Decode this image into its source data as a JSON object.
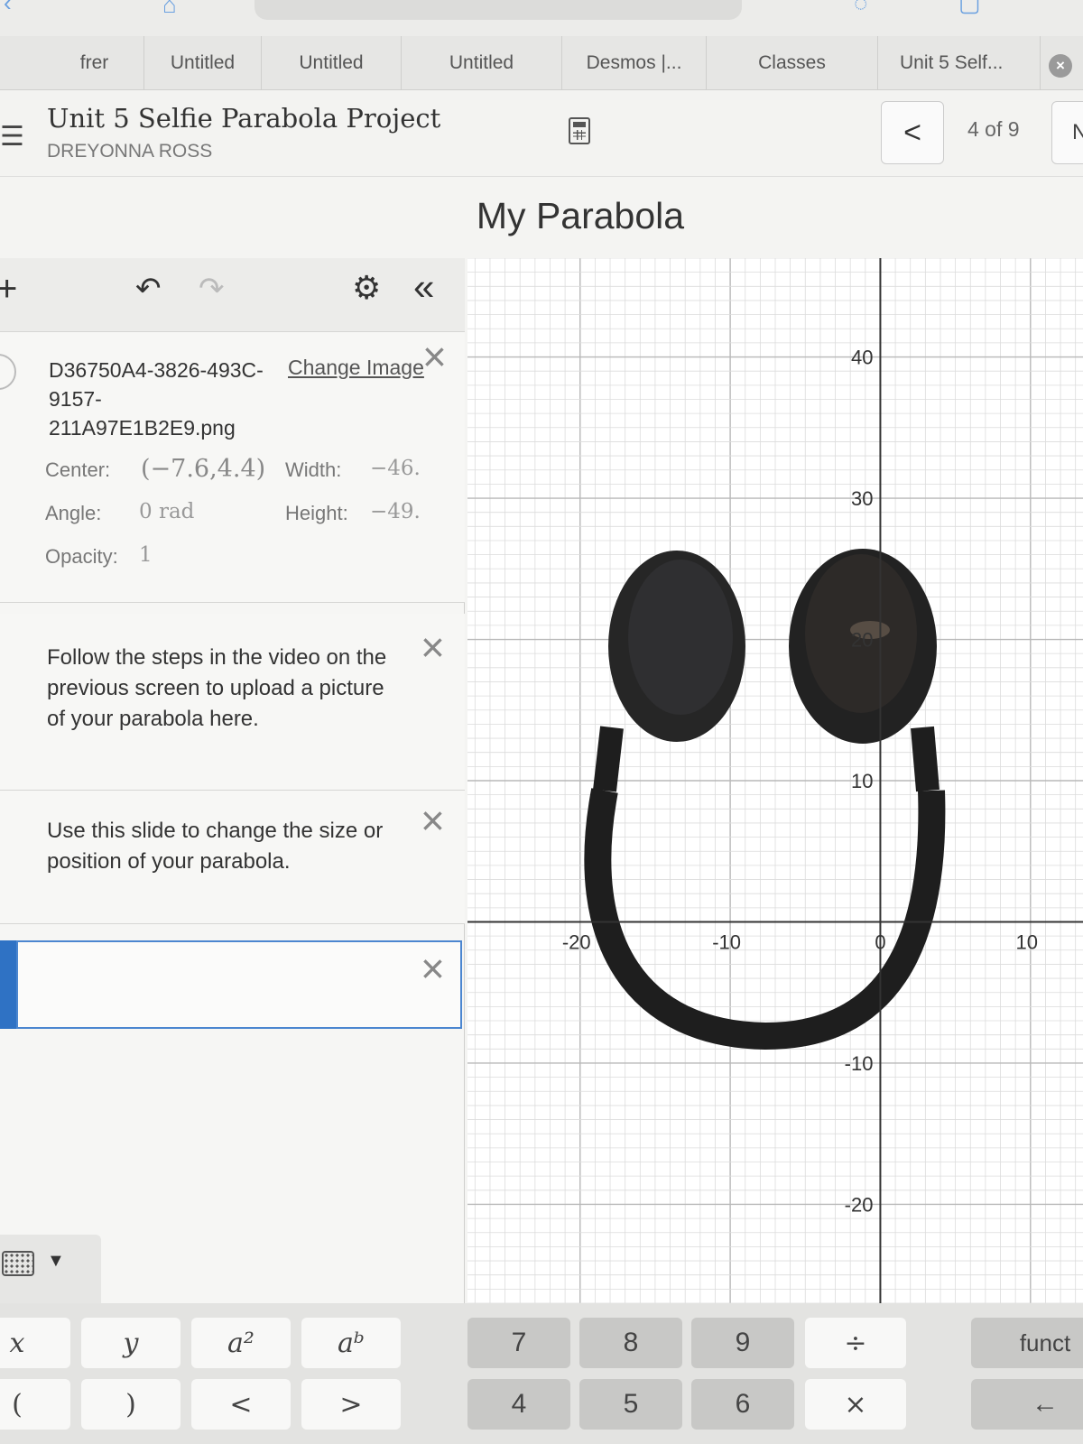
{
  "tabs": [
    {
      "label": "frer"
    },
    {
      "label": "Untitled"
    },
    {
      "label": "Untitled"
    },
    {
      "label": "Untitled"
    },
    {
      "label": "Desmos |..."
    },
    {
      "label": "Classes"
    },
    {
      "label": "Unit 5 Self..."
    }
  ],
  "header": {
    "title": "Unit 5 Selfie Parabola Project",
    "student": "DREYONNA ROSS",
    "page_indicator": "4 of 9",
    "prev_label": "<",
    "next_label": "N"
  },
  "screen_title": "My Parabola",
  "expression_panel": {
    "image_item": {
      "filename": "D36750A4-3826-493C-9157-211A97E1B2E9.png",
      "change_link": "Change Image",
      "center_label": "Center:",
      "center_value": "(−7.6,4.4)",
      "width_label": "Width:",
      "width_value": "−46.",
      "angle_label": "Angle:",
      "angle_value": "0 rad",
      "height_label": "Height:",
      "height_value": "−49.",
      "opacity_label": "Opacity:",
      "opacity_value": "1"
    },
    "notes": [
      "Follow the steps in the video on the previous screen to upload a picture of your parabola here.",
      "Use this slide to change the size or position of your parabola."
    ]
  },
  "keypad": {
    "row1": [
      "x",
      "y",
      "a²",
      "aᵇ",
      "7",
      "8",
      "9",
      "÷",
      "funct"
    ],
    "row2": [
      "(",
      ")",
      "<",
      ">",
      "4",
      "5",
      "6",
      "×",
      "←"
    ]
  },
  "colors": {
    "accent": "#2f72c4",
    "panel_bg": "#f6f6f4",
    "grid_minor": "#dcdcdc",
    "grid_major": "#b8b8b8"
  },
  "chart_data": {
    "type": "scatter",
    "x_ticks": [
      "-20",
      "-10",
      "0",
      "10"
    ],
    "y_ticks": [
      "40",
      "30",
      "20",
      "10",
      "-10",
      "-20"
    ],
    "xlim": [
      -27.5,
      13.5
    ],
    "ylim": [
      -27,
      47
    ]
  }
}
